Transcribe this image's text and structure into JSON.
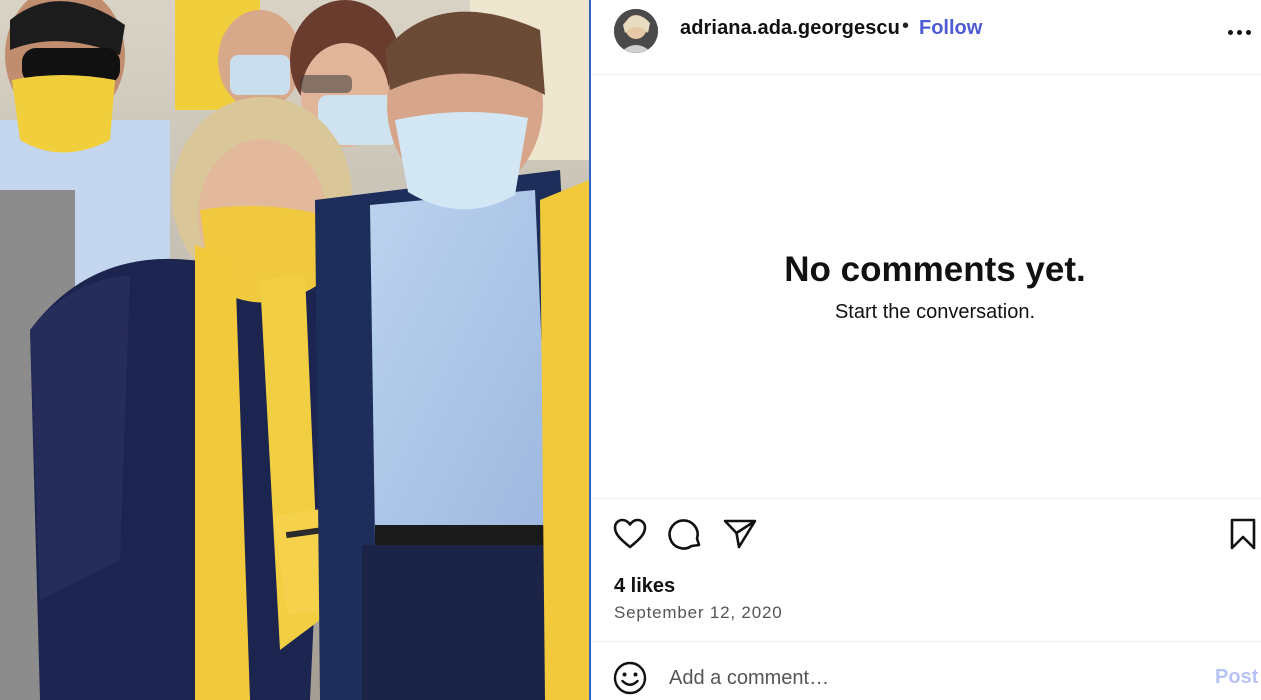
{
  "post": {
    "username": "adriana.ada.georgescu",
    "separator": "•",
    "follow_label": "Follow",
    "more_icon": "more-horizontal-icon"
  },
  "comments": {
    "empty_title": "No comments yet.",
    "empty_subtitle": "Start the conversation."
  },
  "actions": {
    "like_icon": "heart-icon",
    "comment_icon": "comment-bubble-icon",
    "share_icon": "paper-plane-icon",
    "save_icon": "bookmark-icon"
  },
  "stats": {
    "likes": "4 likes",
    "date": "September 12, 2020"
  },
  "composer": {
    "emoji_icon": "smiley-icon",
    "placeholder": "Add a comment…",
    "post_label": "Post"
  },
  "colors": {
    "follow": "#4f5bd5",
    "post_disabled": "#b8c3f5",
    "panel_divider": "#2f61c9",
    "photo_yellow": "#f2c93a"
  }
}
